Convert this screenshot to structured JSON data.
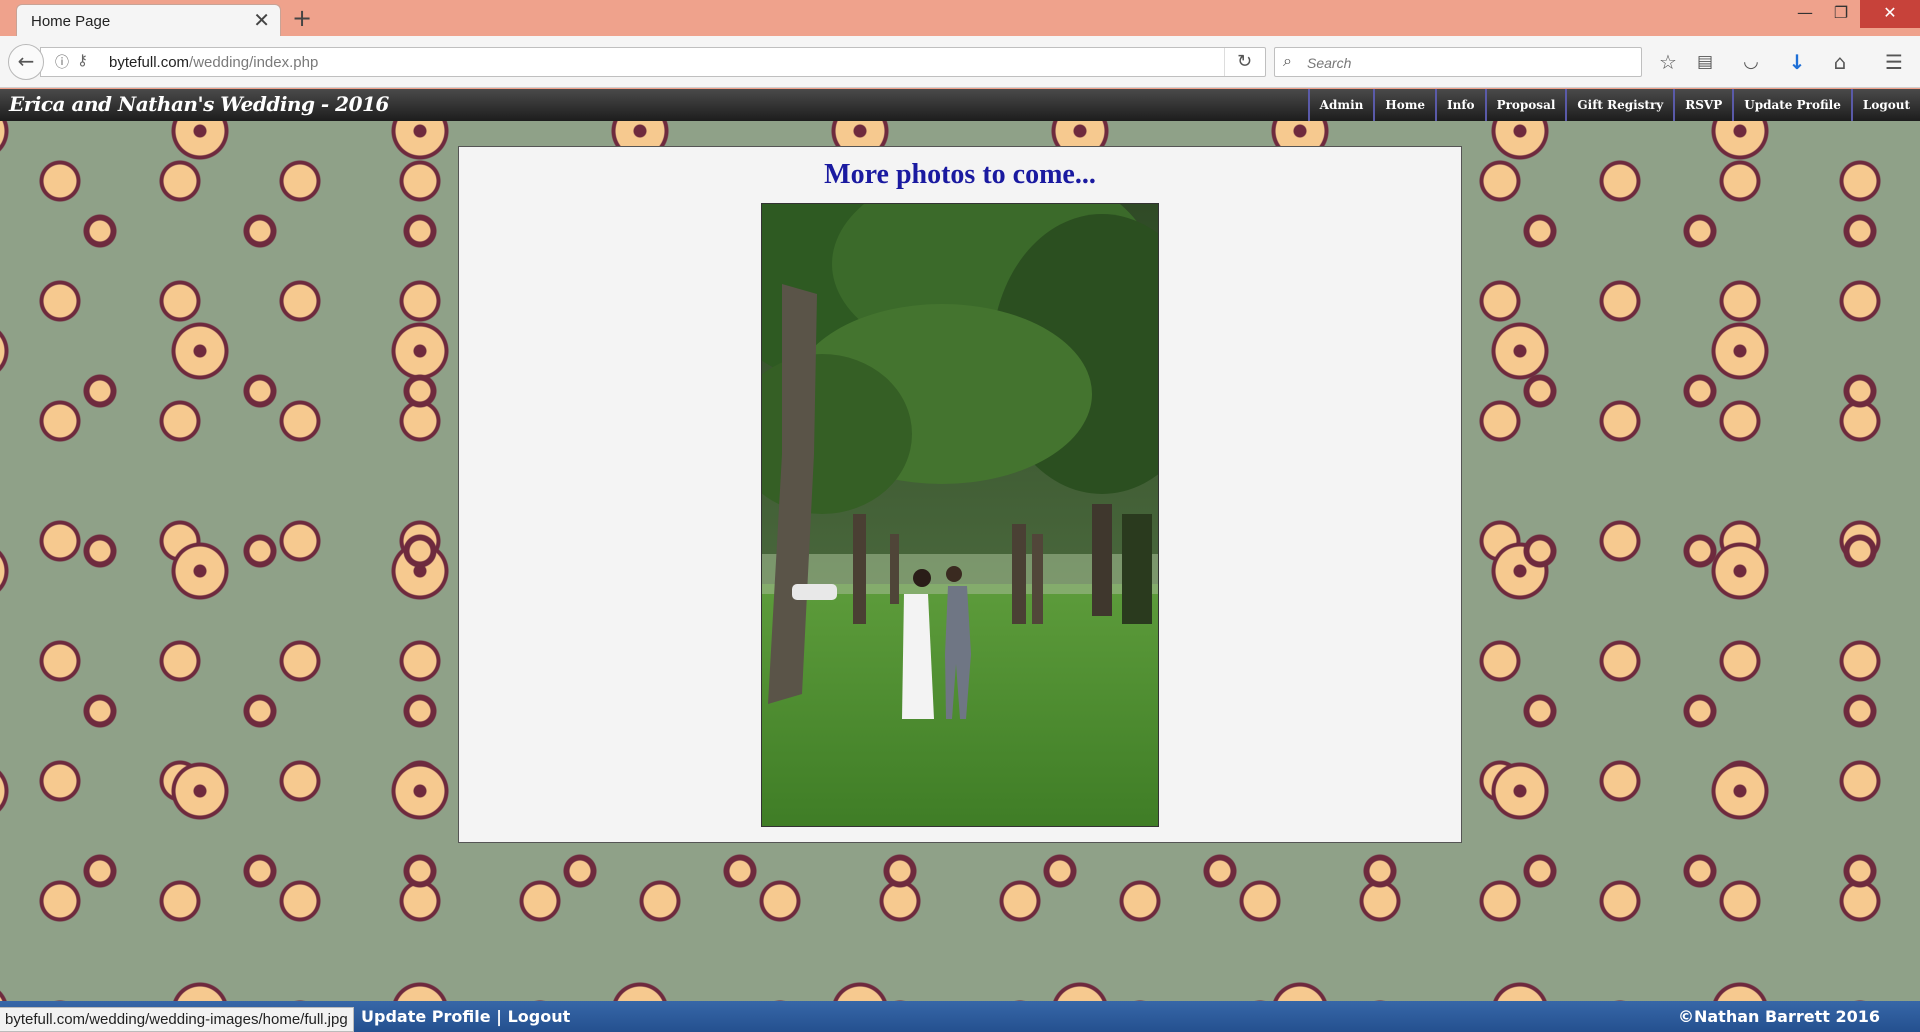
{
  "browser": {
    "tab_title": "Home Page",
    "tab_close": "✕",
    "new_tab": "+",
    "url_host": "bytefull.com",
    "url_path": "/wedding/index.php",
    "search_placeholder": "Search",
    "status_url": "bytefull.com/wedding/wedding-images/home/full.jpg",
    "window_controls": {
      "minimize": "—",
      "maximize": "❐",
      "close": "✕"
    },
    "toolbar_icons": [
      "bookmark-star-icon",
      "reading-list-icon",
      "pocket-icon",
      "downloads-icon",
      "home-icon",
      "menu-icon"
    ]
  },
  "site": {
    "title": "Erica and Nathan's Wedding - 2016",
    "nav": [
      "Admin",
      "Home",
      "Info",
      "Proposal",
      "Gift Registry",
      "RSVP",
      "Update Profile",
      "Logout"
    ],
    "heading": "More photos to come...",
    "footer_links": {
      "update_profile": "Update Profile",
      "separator": "|",
      "logout": "Logout"
    },
    "copyright": "©Nathan Barrett 2016"
  },
  "colors": {
    "header_bg": "#2f2f2f",
    "heading_text": "#1a1aa0",
    "footer_bg": "#2c5a9a",
    "pattern_bg": "#8fa188",
    "pattern_petal": "#f6c98f",
    "pattern_line": "#6e2a3e"
  }
}
